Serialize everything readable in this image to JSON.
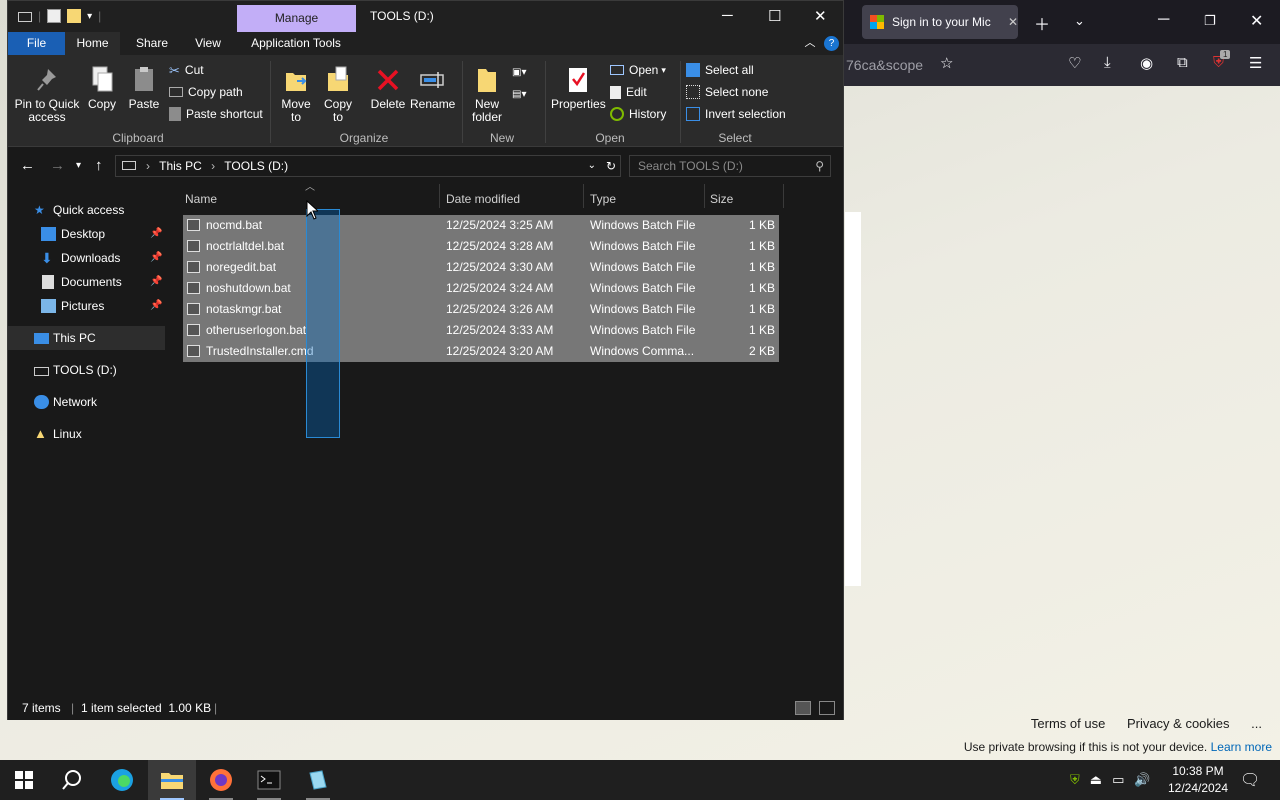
{
  "browser": {
    "tab_title": "Sign in to your Mic",
    "url_fragment": "76ca&scope",
    "extension_badge": "1",
    "footer": {
      "terms": "Terms of use",
      "privacy": "Privacy & cookies",
      "more": "...",
      "note": "Use private browsing if this is not your device.",
      "learn_more": "Learn more"
    }
  },
  "explorer": {
    "manage_tab": "Manage",
    "title": "TOOLS (D:)",
    "menu": {
      "file": "File",
      "home": "Home",
      "share": "Share",
      "view": "View",
      "app_tools": "Application Tools"
    },
    "ribbon": {
      "pin_quick_access": "Pin to Quick access",
      "copy": "Copy",
      "paste": "Paste",
      "cut": "Cut",
      "copy_path": "Copy path",
      "paste_shortcut": "Paste shortcut",
      "move_to": "Move to",
      "copy_to": "Copy to",
      "delete": "Delete",
      "rename": "Rename",
      "new_folder": "New folder",
      "properties": "Properties",
      "open": "Open",
      "edit": "Edit",
      "history": "History",
      "select_all": "Select all",
      "select_none": "Select none",
      "invert_selection": "Invert selection",
      "groups": {
        "clipboard": "Clipboard",
        "organize": "Organize",
        "new": "New",
        "open": "Open",
        "select": "Select"
      }
    },
    "address": {
      "crumbs": [
        "This PC",
        "TOOLS (D:)"
      ],
      "search_placeholder": "Search TOOLS (D:)"
    },
    "nav": {
      "quick_access": "Quick access",
      "desktop": "Desktop",
      "downloads": "Downloads",
      "documents": "Documents",
      "pictures": "Pictures",
      "this_pc": "This PC",
      "tools": "TOOLS (D:)",
      "network": "Network",
      "linux": "Linux"
    },
    "columns": {
      "name": "Name",
      "date": "Date modified",
      "type": "Type",
      "size": "Size"
    },
    "files": [
      {
        "name": "nocmd.bat",
        "date": "12/25/2024 3:25 AM",
        "type": "Windows Batch File",
        "size": "1 KB"
      },
      {
        "name": "noctrlaltdel.bat",
        "date": "12/25/2024 3:28 AM",
        "type": "Windows Batch File",
        "size": "1 KB"
      },
      {
        "name": "noregedit.bat",
        "date": "12/25/2024 3:30 AM",
        "type": "Windows Batch File",
        "size": "1 KB"
      },
      {
        "name": "noshutdown.bat",
        "date": "12/25/2024 3:24 AM",
        "type": "Windows Batch File",
        "size": "1 KB"
      },
      {
        "name": "notaskmgr.bat",
        "date": "12/25/2024 3:26 AM",
        "type": "Windows Batch File",
        "size": "1 KB"
      },
      {
        "name": "otheruserlogon.bat",
        "date": "12/25/2024 3:33 AM",
        "type": "Windows Batch File",
        "size": "1 KB"
      },
      {
        "name": "TrustedInstaller.cmd",
        "date": "12/25/2024 3:20 AM",
        "type": "Windows Comma...",
        "size": "2 KB"
      }
    ],
    "status": {
      "items": "7 items",
      "selected": "1 item selected  1.00 KB"
    }
  },
  "taskbar": {
    "time": "10:38 PM",
    "date": "12/24/2024"
  },
  "colors": {
    "accent": "#1a5fb4",
    "manage": "#c2aef7",
    "selection": "#777777",
    "marquee": "#2a8ad4"
  }
}
